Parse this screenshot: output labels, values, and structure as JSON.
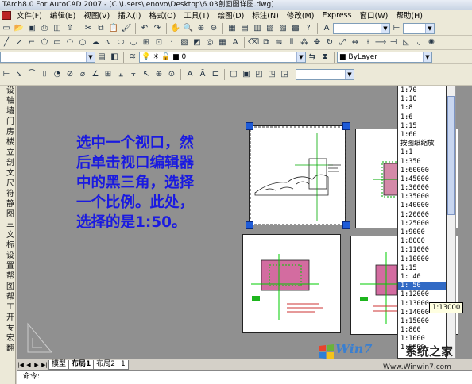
{
  "window": {
    "title": "TArch8.0 For AutoCAD 2007 - [C:\\Users\\lenovo\\Desktop\\6.03剖面图详图.dwg]"
  },
  "menu": [
    "文件(F)",
    "编辑(E)",
    "视图(V)",
    "插入(I)",
    "格式(O)",
    "工具(T)",
    "绘图(D)",
    "标注(N)",
    "修改(M)",
    "Express",
    "窗口(W)",
    "帮助(H)"
  ],
  "toolbar": {
    "layer_value": "0",
    "color_value": "ByLayer",
    "scale_value": ""
  },
  "left_panel": [
    "设",
    "轴",
    "墙",
    "门",
    "房",
    "楼",
    "立",
    "剖",
    "文",
    "尺",
    "符",
    "静",
    "图",
    "三",
    "文",
    "标",
    "设",
    "置",
    "帮",
    "图",
    "帮",
    "工",
    "开",
    "专",
    "宏",
    "翻"
  ],
  "instruction": [
    "选中一个视口，然",
    "后单击视口编辑器",
    "中的黑三角，选择",
    "一个比例。此处，",
    "选择的是1:50。"
  ],
  "scale_options": [
    "1:70",
    "1:10",
    "1:8",
    "1:6",
    "1:15",
    "1:60",
    "按图纸缩放",
    "1:1",
    "1:350",
    "1:60000",
    "1:45000",
    "1:30000",
    "1:35000",
    "1:40000",
    "1:20000",
    "1:25000",
    "1:9000",
    "1:8000",
    "1:11000",
    "1:10000",
    "1:15",
    "1: 40",
    "1: 50",
    "1:12000",
    "1:13000",
    "1:14000",
    "1:15000",
    "1:800",
    "1:1000",
    "1:6000"
  ],
  "selected_scale": "1: 50",
  "tooltip": "1:13000",
  "tabs": [
    "模型",
    "布局1",
    "布局2",
    "1"
  ],
  "command": "命令:",
  "watermark": {
    "brand": "Win7",
    "site": "系统之家",
    "url": "Www.Winwin7.com"
  }
}
